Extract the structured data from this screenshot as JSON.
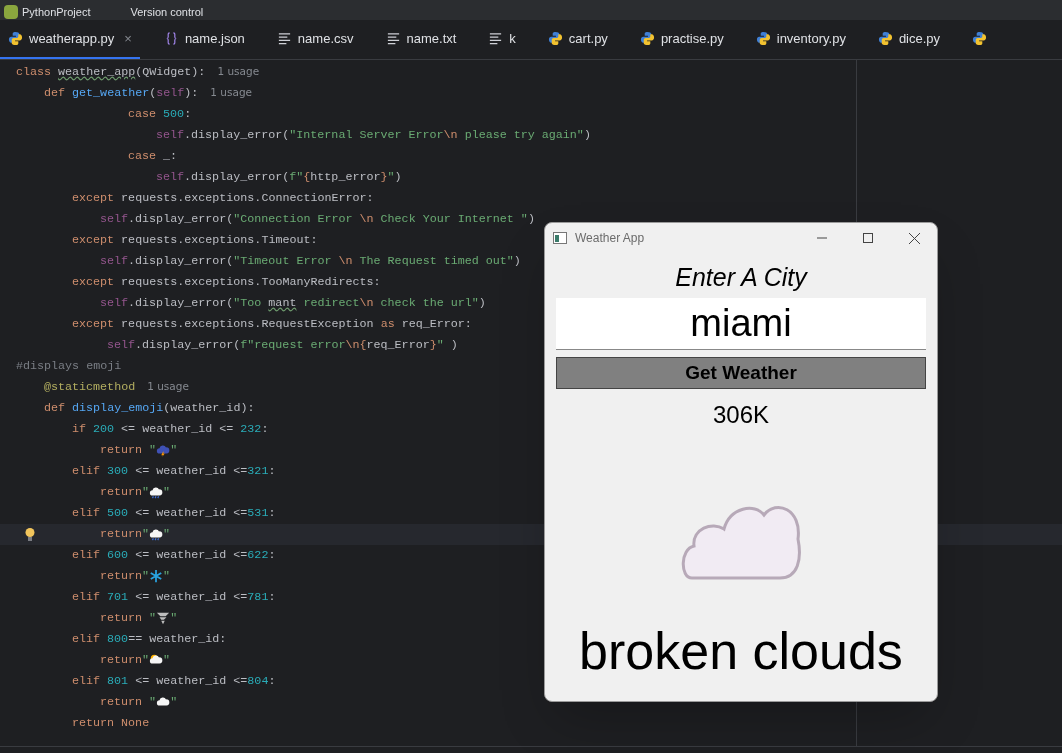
{
  "top_bar": {
    "project": "PythonProject",
    "vcs": "Version control"
  },
  "tabs": [
    {
      "label": "weatherapp.py",
      "kind": "py",
      "selected": true,
      "close": "×"
    },
    {
      "label": "name.json",
      "kind": "json",
      "selected": false
    },
    {
      "label": "name.csv",
      "kind": "text",
      "selected": false
    },
    {
      "label": "name.txt",
      "kind": "text",
      "selected": false
    },
    {
      "label": "k",
      "kind": "text",
      "selected": false
    },
    {
      "label": "cart.py",
      "kind": "py",
      "selected": false
    },
    {
      "label": "practise.py",
      "kind": "py",
      "selected": false
    },
    {
      "label": "inventory.py",
      "kind": "py",
      "selected": false
    },
    {
      "label": "dice.py",
      "kind": "py",
      "selected": false
    },
    {
      "kind": "py",
      "selected": false
    }
  ],
  "code_lines": [
    {
      "current": false,
      "tokens": [
        {
          "kind": "kw",
          "text": "class "
        },
        {
          "kind": "typo",
          "text": "weather_app"
        },
        {
          "kind": "plain",
          "text": "(QWidget):"
        },
        {
          "kind": "hint",
          "text": "1 usage"
        }
      ]
    },
    {
      "current": false,
      "tokens": [
        {
          "kind": "kw",
          "text": "    def "
        },
        {
          "kind": "fn",
          "text": "get_weather"
        },
        {
          "kind": "plain",
          "text": "("
        },
        {
          "kind": "self",
          "text": "self"
        },
        {
          "kind": "plain",
          "text": "):"
        },
        {
          "kind": "hint",
          "text": "1 usage"
        }
      ]
    },
    {
      "current": false,
      "tokens": [
        {
          "kind": "kw",
          "text": "                case "
        },
        {
          "kind": "num",
          "text": "500"
        },
        {
          "kind": "plain",
          "text": ":"
        }
      ]
    },
    {
      "current": false,
      "tokens": [
        {
          "kind": "self",
          "text": "                    self"
        },
        {
          "kind": "plain",
          "text": ".display_error("
        },
        {
          "kind": "str",
          "text": "\"Internal Server Error"
        },
        {
          "kind": "esc",
          "text": "\\n"
        },
        {
          "kind": "str",
          "text": " please try again\""
        },
        {
          "kind": "plain",
          "text": ")"
        }
      ]
    },
    {
      "current": false,
      "tokens": [
        {
          "kind": "kw",
          "text": "                case "
        },
        {
          "kind": "plain",
          "text": "_:"
        }
      ]
    },
    {
      "current": false,
      "tokens": [
        {
          "kind": "self",
          "text": "                    self"
        },
        {
          "kind": "plain",
          "text": ".display_error("
        },
        {
          "kind": "str",
          "text": "f\""
        },
        {
          "kind": "esc",
          "text": "{"
        },
        {
          "kind": "plain",
          "text": "http_error"
        },
        {
          "kind": "esc",
          "text": "}"
        },
        {
          "kind": "str",
          "text": "\""
        },
        {
          "kind": "plain",
          "text": ")"
        }
      ]
    },
    {
      "current": false,
      "tokens": [
        {
          "kind": "kw",
          "text": "        except "
        },
        {
          "kind": "plain",
          "text": "requests.exceptions.ConnectionError:"
        }
      ]
    },
    {
      "current": false,
      "tokens": [
        {
          "kind": "self",
          "text": "            self"
        },
        {
          "kind": "plain",
          "text": ".display_error("
        },
        {
          "kind": "str",
          "text": "\"Connection Error "
        },
        {
          "kind": "esc",
          "text": "\\n"
        },
        {
          "kind": "str",
          "text": " Check Your Internet \""
        },
        {
          "kind": "plain",
          "text": ")"
        }
      ]
    },
    {
      "current": false,
      "tokens": [
        {
          "kind": "kw",
          "text": "        except "
        },
        {
          "kind": "plain",
          "text": "requests.exceptions.Timeout:"
        }
      ]
    },
    {
      "current": false,
      "tokens": [
        {
          "kind": "self",
          "text": "            self"
        },
        {
          "kind": "plain",
          "text": ".display_error("
        },
        {
          "kind": "str",
          "text": "\"Timeout Error "
        },
        {
          "kind": "esc",
          "text": "\\n"
        },
        {
          "kind": "str",
          "text": " The Request timed out\""
        },
        {
          "kind": "plain",
          "text": ")"
        }
      ]
    },
    {
      "current": false,
      "tokens": [
        {
          "kind": "kw",
          "text": "        except "
        },
        {
          "kind": "plain",
          "text": "requests.exceptions.TooManyRedirects:"
        }
      ]
    },
    {
      "current": false,
      "tokens": [
        {
          "kind": "self",
          "text": "            self"
        },
        {
          "kind": "plain",
          "text": ".display_error("
        },
        {
          "kind": "str",
          "text": "\"Too "
        },
        {
          "kind": "typo",
          "text": "mant"
        },
        {
          "kind": "str",
          "text": " redirect"
        },
        {
          "kind": "esc",
          "text": "\\n"
        },
        {
          "kind": "str",
          "text": " check the url\""
        },
        {
          "kind": "plain",
          "text": ")"
        }
      ]
    },
    {
      "current": false,
      "tokens": [
        {
          "kind": "kw",
          "text": "        except "
        },
        {
          "kind": "plain",
          "text": "requests.exceptions.RequestException "
        },
        {
          "kind": "kw",
          "text": "as "
        },
        {
          "kind": "plain",
          "text": "req_Error:"
        }
      ]
    },
    {
      "current": false,
      "tokens": [
        {
          "kind": "self",
          "text": "             self"
        },
        {
          "kind": "plain",
          "text": ".display_error("
        },
        {
          "kind": "str",
          "text": "f\"request error"
        },
        {
          "kind": "esc",
          "text": "\\n{"
        },
        {
          "kind": "plain",
          "text": "req_Error"
        },
        {
          "kind": "esc",
          "text": "}"
        },
        {
          "kind": "str",
          "text": "\""
        },
        {
          "kind": "plain",
          "text": " )"
        }
      ]
    },
    {
      "current": false,
      "tokens": [
        {
          "kind": "comment",
          "text": "#displays emoji"
        }
      ]
    },
    {
      "current": false,
      "tokens": [
        {
          "kind": "deco",
          "text": "    @staticmethod"
        },
        {
          "kind": "hint",
          "text": "1 usage"
        }
      ]
    },
    {
      "current": false,
      "tokens": [
        {
          "kind": "kw",
          "text": "    def "
        },
        {
          "kind": "fn",
          "text": "display_emoji"
        },
        {
          "kind": "plain",
          "text": "(weather_id):"
        }
      ]
    },
    {
      "current": false,
      "tokens": [
        {
          "kind": "kw",
          "text": "        if "
        },
        {
          "kind": "num",
          "text": "200"
        },
        {
          "kind": "plain",
          "text": " <= weather_id <= "
        },
        {
          "kind": "num",
          "text": "232"
        },
        {
          "kind": "plain",
          "text": ":"
        }
      ]
    },
    {
      "current": false,
      "tokens": [
        {
          "kind": "kw",
          "text": "            return "
        },
        {
          "kind": "str",
          "text": "\""
        },
        {
          "kind": "icon"
        },
        {
          "kind": "str",
          "text": "\""
        }
      ]
    },
    {
      "current": false,
      "tokens": [
        {
          "kind": "kw",
          "text": "        elif "
        },
        {
          "kind": "num",
          "text": "300"
        },
        {
          "kind": "plain",
          "text": " <= weather_id <="
        },
        {
          "kind": "num",
          "text": "321"
        },
        {
          "kind": "plain",
          "text": ":"
        }
      ]
    },
    {
      "current": false,
      "tokens": [
        {
          "kind": "kw",
          "text": "            return"
        },
        {
          "kind": "str",
          "text": "\""
        },
        {
          "kind": "icon"
        },
        {
          "kind": "str",
          "text": "\""
        }
      ]
    },
    {
      "current": false,
      "tokens": [
        {
          "kind": "kw",
          "text": "        elif "
        },
        {
          "kind": "num",
          "text": "500"
        },
        {
          "kind": "plain",
          "text": " <= weather_id <="
        },
        {
          "kind": "num",
          "text": "531"
        },
        {
          "kind": "plain",
          "text": ":"
        }
      ]
    },
    {
      "current": true,
      "tokens": [
        {
          "kind": "kw",
          "text": "            return"
        },
        {
          "kind": "str",
          "text": "\""
        },
        {
          "kind": "icon"
        },
        {
          "kind": "str",
          "text": "\""
        }
      ]
    },
    {
      "current": false,
      "tokens": [
        {
          "kind": "kw",
          "text": "        elif "
        },
        {
          "kind": "num",
          "text": "600"
        },
        {
          "kind": "plain",
          "text": " <= weather_id <="
        },
        {
          "kind": "num",
          "text": "622"
        },
        {
          "kind": "plain",
          "text": ":"
        }
      ]
    },
    {
      "current": false,
      "tokens": [
        {
          "kind": "kw",
          "text": "            return"
        },
        {
          "kind": "str",
          "text": "\""
        },
        {
          "kind": "icon"
        },
        {
          "kind": "str",
          "text": "\""
        }
      ]
    },
    {
      "current": false,
      "tokens": [
        {
          "kind": "kw",
          "text": "        elif "
        },
        {
          "kind": "num",
          "text": "701"
        },
        {
          "kind": "plain",
          "text": " <= weather_id <="
        },
        {
          "kind": "num",
          "text": "781"
        },
        {
          "kind": "plain",
          "text": ":"
        }
      ]
    },
    {
      "current": false,
      "tokens": [
        {
          "kind": "kw",
          "text": "            return "
        },
        {
          "kind": "str",
          "text": "\""
        },
        {
          "kind": "icon"
        },
        {
          "kind": "str",
          "text": "\""
        }
      ]
    },
    {
      "current": false,
      "tokens": [
        {
          "kind": "kw",
          "text": "        elif "
        },
        {
          "kind": "num",
          "text": "800"
        },
        {
          "kind": "plain",
          "text": "== weather_id:"
        }
      ]
    },
    {
      "current": false,
      "tokens": [
        {
          "kind": "kw",
          "text": "            return"
        },
        {
          "kind": "str",
          "text": "\""
        },
        {
          "kind": "icon"
        },
        {
          "kind": "str",
          "text": "\""
        }
      ]
    },
    {
      "current": false,
      "tokens": [
        {
          "kind": "kw",
          "text": "        elif "
        },
        {
          "kind": "num",
          "text": "801"
        },
        {
          "kind": "plain",
          "text": " <= weather_id <="
        },
        {
          "kind": "num",
          "text": "804"
        },
        {
          "kind": "plain",
          "text": ":"
        }
      ]
    },
    {
      "current": false,
      "tokens": [
        {
          "kind": "kw",
          "text": "            return "
        },
        {
          "kind": "str",
          "text": "\""
        },
        {
          "kind": "icon"
        },
        {
          "kind": "str",
          "text": "\""
        }
      ]
    },
    {
      "current": false,
      "tokens": [
        {
          "kind": "kw",
          "text": "        return None"
        }
      ]
    }
  ],
  "app_window": {
    "title": "Weather App",
    "prompt": "Enter A City",
    "city": "miami",
    "button": "Get Weather",
    "temperature": "306K",
    "description": "broken clouds"
  }
}
